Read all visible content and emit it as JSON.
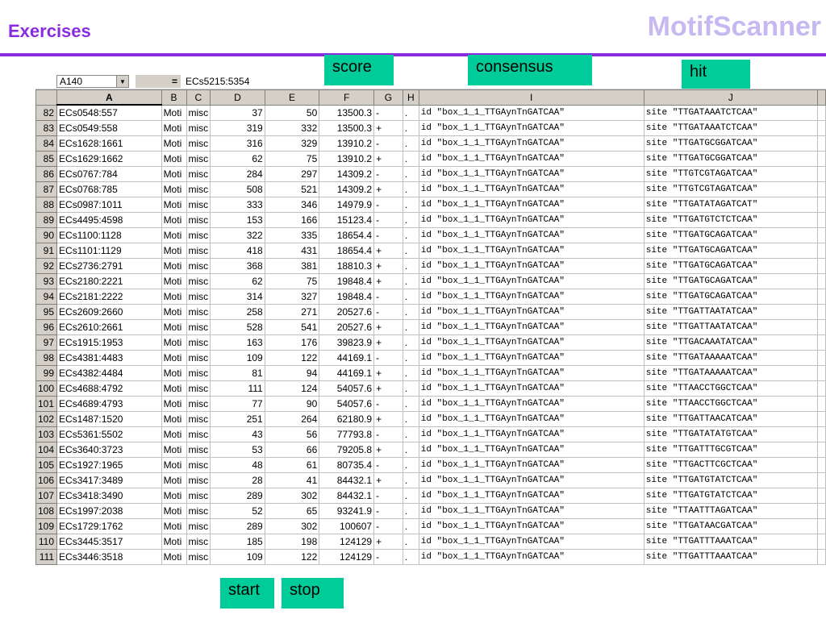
{
  "slide": {
    "title": "Exercises",
    "brand": "MotifScanner"
  },
  "callouts": {
    "score": "score",
    "consensus": "consensus",
    "hit": "hit",
    "start": "start",
    "stop": "stop"
  },
  "formula_bar": {
    "name_box": "A140",
    "equals": "=",
    "formula": "ECs5215:5354"
  },
  "columns": [
    "",
    "A",
    "B",
    "C",
    "D",
    "E",
    "F",
    "G",
    "H",
    "I",
    "J",
    ""
  ],
  "rows": [
    [
      "82",
      "ECs0548:557",
      "Moti",
      "misc",
      "37",
      "50",
      "13500.3",
      "-",
      ".",
      "id \"box_1_1_TTGAynTnGATCAA\"",
      "site \"TTGATAAATCTCAA\""
    ],
    [
      "83",
      "ECs0549:558",
      "Moti",
      "misc",
      "319",
      "332",
      "13500.3",
      "+",
      ".",
      "id \"box_1_1_TTGAynTnGATCAA\"",
      "site \"TTGATAAATCTCAA\""
    ],
    [
      "84",
      "ECs1628:1661",
      "Moti",
      "misc",
      "316",
      "329",
      "13910.2",
      "-",
      ".",
      "id \"box_1_1_TTGAynTnGATCAA\"",
      "site \"TTGATGCGGATCAA\""
    ],
    [
      "85",
      "ECs1629:1662",
      "Moti",
      "misc",
      "62",
      "75",
      "13910.2",
      "+",
      ".",
      "id \"box_1_1_TTGAynTnGATCAA\"",
      "site \"TTGATGCGGATCAA\""
    ],
    [
      "86",
      "ECs0767:784",
      "Moti",
      "misc",
      "284",
      "297",
      "14309.2",
      "-",
      ".",
      "id \"box_1_1_TTGAynTnGATCAA\"",
      "site \"TTGTCGTAGATCAA\""
    ],
    [
      "87",
      "ECs0768:785",
      "Moti",
      "misc",
      "508",
      "521",
      "14309.2",
      "+",
      ".",
      "id \"box_1_1_TTGAynTnGATCAA\"",
      "site \"TTGTCGTAGATCAA\""
    ],
    [
      "88",
      "ECs0987:1011",
      "Moti",
      "misc",
      "333",
      "346",
      "14979.9",
      "-",
      ".",
      "id \"box_1_1_TTGAynTnGATCAA\"",
      "site \"TTGATATAGATCAT\""
    ],
    [
      "89",
      "ECs4495:4598",
      "Moti",
      "misc",
      "153",
      "166",
      "15123.4",
      "-",
      ".",
      "id \"box_1_1_TTGAynTnGATCAA\"",
      "site \"TTGATGTCTCTCAA\""
    ],
    [
      "90",
      "ECs1100:1128",
      "Moti",
      "misc",
      "322",
      "335",
      "18654.4",
      "-",
      ".",
      "id \"box_1_1_TTGAynTnGATCAA\"",
      "site \"TTGATGCAGATCAA\""
    ],
    [
      "91",
      "ECs1101:1129",
      "Moti",
      "misc",
      "418",
      "431",
      "18654.4",
      "+",
      ".",
      "id \"box_1_1_TTGAynTnGATCAA\"",
      "site \"TTGATGCAGATCAA\""
    ],
    [
      "92",
      "ECs2736:2791",
      "Moti",
      "misc",
      "368",
      "381",
      "18810.3",
      "+",
      ".",
      "id \"box_1_1_TTGAynTnGATCAA\"",
      "site \"TTGATGCAGATCAA\""
    ],
    [
      "93",
      "ECs2180:2221",
      "Moti",
      "misc",
      "62",
      "75",
      "19848.4",
      "+",
      ".",
      "id \"box_1_1_TTGAynTnGATCAA\"",
      "site \"TTGATGCAGATCAA\""
    ],
    [
      "94",
      "ECs2181:2222",
      "Moti",
      "misc",
      "314",
      "327",
      "19848.4",
      "-",
      ".",
      "id \"box_1_1_TTGAynTnGATCAA\"",
      "site \"TTGATGCAGATCAA\""
    ],
    [
      "95",
      "ECs2609:2660",
      "Moti",
      "misc",
      "258",
      "271",
      "20527.6",
      "-",
      ".",
      "id \"box_1_1_TTGAynTnGATCAA\"",
      "site \"TTGATTAATATCAA\""
    ],
    [
      "96",
      "ECs2610:2661",
      "Moti",
      "misc",
      "528",
      "541",
      "20527.6",
      "+",
      ".",
      "id \"box_1_1_TTGAynTnGATCAA\"",
      "site \"TTGATTAATATCAA\""
    ],
    [
      "97",
      "ECs1915:1953",
      "Moti",
      "misc",
      "163",
      "176",
      "39823.9",
      "+",
      ".",
      "id \"box_1_1_TTGAynTnGATCAA\"",
      "site \"TTGACAAATATCAA\""
    ],
    [
      "98",
      "ECs4381:4483",
      "Moti",
      "misc",
      "109",
      "122",
      "44169.1",
      "-",
      ".",
      "id \"box_1_1_TTGAynTnGATCAA\"",
      "site \"TTGATAAAAATCAA\""
    ],
    [
      "99",
      "ECs4382:4484",
      "Moti",
      "misc",
      "81",
      "94",
      "44169.1",
      "+",
      ".",
      "id \"box_1_1_TTGAynTnGATCAA\"",
      "site \"TTGATAAAAATCAA\""
    ],
    [
      "100",
      "ECs4688:4792",
      "Moti",
      "misc",
      "111",
      "124",
      "54057.6",
      "+",
      ".",
      "id \"box_1_1_TTGAynTnGATCAA\"",
      "site \"TTAACCTGGCTCAA\""
    ],
    [
      "101",
      "ECs4689:4793",
      "Moti",
      "misc",
      "77",
      "90",
      "54057.6",
      "-",
      ".",
      "id \"box_1_1_TTGAynTnGATCAA\"",
      "site \"TTAACCTGGCTCAA\""
    ],
    [
      "102",
      "ECs1487:1520",
      "Moti",
      "misc",
      "251",
      "264",
      "62180.9",
      "+",
      ".",
      "id \"box_1_1_TTGAynTnGATCAA\"",
      "site \"TTGATTAACATCAA\""
    ],
    [
      "103",
      "ECs5361:5502",
      "Moti",
      "misc",
      "43",
      "56",
      "77793.8",
      "-",
      ".",
      "id \"box_1_1_TTGAynTnGATCAA\"",
      "site \"TTGATATATGTCAA\""
    ],
    [
      "104",
      "ECs3640:3723",
      "Moti",
      "misc",
      "53",
      "66",
      "79205.8",
      "+",
      ".",
      "id \"box_1_1_TTGAynTnGATCAA\"",
      "site \"TTGATTTGCGTCAA\""
    ],
    [
      "105",
      "ECs1927:1965",
      "Moti",
      "misc",
      "48",
      "61",
      "80735.4",
      "-",
      ".",
      "id \"box_1_1_TTGAynTnGATCAA\"",
      "site \"TTGACTTCGCTCAA\""
    ],
    [
      "106",
      "ECs3417:3489",
      "Moti",
      "misc",
      "28",
      "41",
      "84432.1",
      "+",
      ".",
      "id \"box_1_1_TTGAynTnGATCAA\"",
      "site \"TTGATGTATCTCAA\""
    ],
    [
      "107",
      "ECs3418:3490",
      "Moti",
      "misc",
      "289",
      "302",
      "84432.1",
      "-",
      ".",
      "id \"box_1_1_TTGAynTnGATCAA\"",
      "site \"TTGATGTATCTCAA\""
    ],
    [
      "108",
      "ECs1997:2038",
      "Moti",
      "misc",
      "52",
      "65",
      "93241.9",
      "-",
      ".",
      "id \"box_1_1_TTGAynTnGATCAA\"",
      "site \"TTAATTTAGATCAA\""
    ],
    [
      "109",
      "ECs1729:1762",
      "Moti",
      "misc",
      "289",
      "302",
      "100607",
      "-",
      ".",
      "id \"box_1_1_TTGAynTnGATCAA\"",
      "site \"TTGATAACGATCAA\""
    ],
    [
      "110",
      "ECs3445:3517",
      "Moti",
      "misc",
      "185",
      "198",
      "124129",
      "+",
      ".",
      "id \"box_1_1_TTGAynTnGATCAA\"",
      "site \"TTGATTTAAATCAA\""
    ],
    [
      "111",
      "ECs3446:3518",
      "Moti",
      "misc",
      "109",
      "122",
      "124129",
      "-",
      ".",
      "id \"box_1_1_TTGAynTnGATCAA\"",
      "site \"TTGATTTAAATCAA\""
    ]
  ]
}
